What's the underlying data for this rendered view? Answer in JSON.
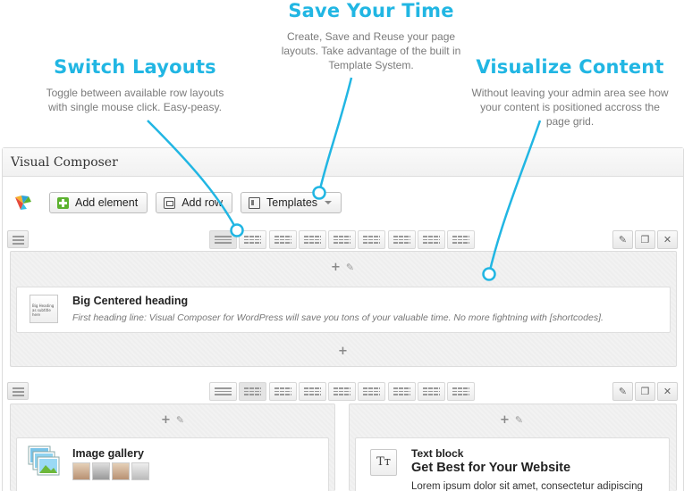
{
  "callouts": {
    "save": {
      "title": "Save Your Time",
      "line1": "Create, Save and Reuse your page",
      "line2": "layouts. Take advantage of the built in",
      "line3": "Template System."
    },
    "switch": {
      "title": "Switch Layouts",
      "line1": "Toggle between available row layouts",
      "line2": "with single mouse click. Easy-peasy."
    },
    "visualize": {
      "title": "Visualize Content",
      "line1": "Without leaving your admin area see how",
      "line2": "your content is positioned accross the",
      "line3": "page grid."
    }
  },
  "panel": {
    "title": "Visual Composer"
  },
  "toolbar": {
    "add_element": "Add element",
    "add_row": "Add row",
    "templates": "Templates"
  },
  "row1": {
    "element": {
      "title": "Big Centered heading",
      "desc": "First heading line: Visual Composer for WordPress will save you tons of your valuable time. No more fightning with [shortcodes].",
      "thumb_line1": "Big Heading",
      "thumb_line2": "as subtitle here"
    }
  },
  "row2": {
    "left": {
      "title": "Image gallery"
    },
    "right": {
      "title": "Text block",
      "heading": "Get Best for Your Website",
      "body": "Lorem ipsum dolor sit amet, consectetur adipiscing",
      "icon_text": "Tт"
    }
  },
  "colors": {
    "accent": "#21b6e3",
    "green": "#5cb22f"
  },
  "icons": {
    "move": "hamburger-icon",
    "edit": "pencil-icon",
    "clone": "copy-icon",
    "delete": "close-icon",
    "add": "plus-icon"
  }
}
